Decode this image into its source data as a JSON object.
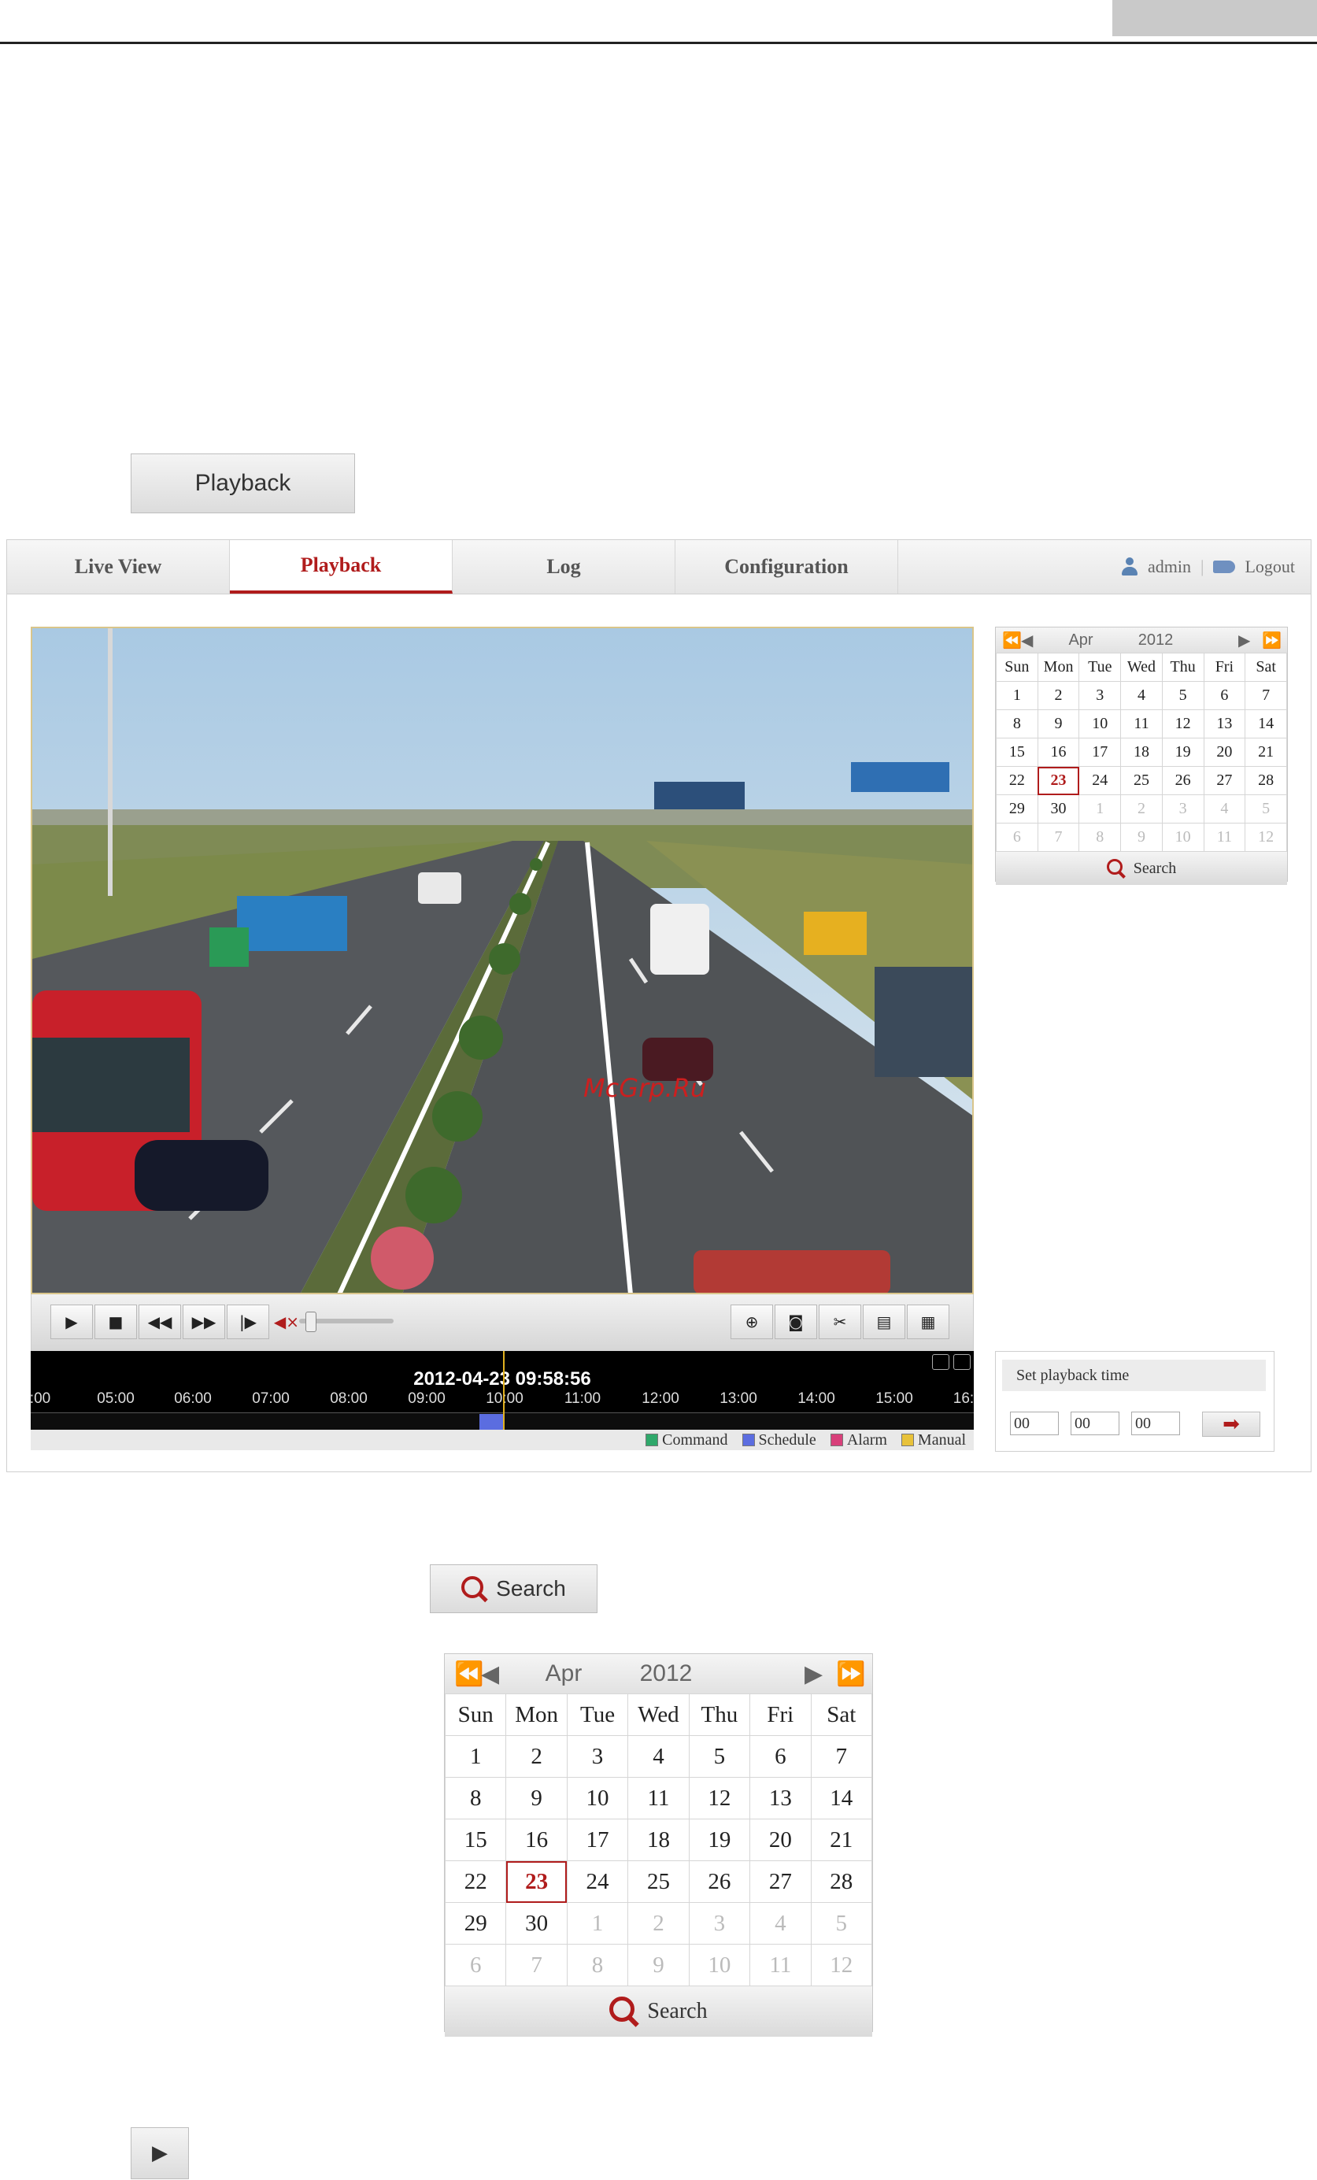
{
  "doc": {
    "playback_button": "Playback"
  },
  "nav": {
    "tabs": [
      "Live View",
      "Playback",
      "Log",
      "Configuration"
    ],
    "active_tab": "Playback",
    "user": "admin",
    "separator": "|",
    "logout": "Logout"
  },
  "player": {
    "watermark": "McGrp.Ru",
    "controls": [
      "play-icon",
      "stop-icon",
      "slow-forward-icon",
      "fast-forward-icon",
      "single-frame-icon",
      "volume-mute-icon",
      "zoom-in-icon",
      "capture-picture-icon",
      "clip-icon",
      "download-video-icon",
      "download-picture-icon"
    ],
    "timestamp": "2012-04-23 09:58:56",
    "ticks": [
      ":00",
      "05:00",
      "06:00",
      "07:00",
      "08:00",
      "09:00",
      "10:00",
      "11:00",
      "12:00",
      "13:00",
      "14:00",
      "15:00",
      "16:"
    ],
    "legend": [
      {
        "label": "Command",
        "color": "#2fa86b"
      },
      {
        "label": "Schedule",
        "color": "#5b6de0"
      },
      {
        "label": "Alarm",
        "color": "#d8407a"
      },
      {
        "label": "Manual",
        "color": "#e8c23a"
      }
    ]
  },
  "calendar": {
    "month": "Apr",
    "year": "2012",
    "weekdays": [
      "Sun",
      "Mon",
      "Tue",
      "Wed",
      "Thu",
      "Fri",
      "Sat"
    ],
    "weeks": [
      [
        "1",
        "2",
        "3",
        "4",
        "5",
        "6",
        "7"
      ],
      [
        "8",
        "9",
        "10",
        "11",
        "12",
        "13",
        "14"
      ],
      [
        "15",
        "16",
        "17",
        "18",
        "19",
        "20",
        "21"
      ],
      [
        "22",
        "23",
        "24",
        "25",
        "26",
        "27",
        "28"
      ],
      [
        "29",
        "30",
        "1",
        "2",
        "3",
        "4",
        "5"
      ],
      [
        "6",
        "7",
        "8",
        "9",
        "10",
        "11",
        "12"
      ]
    ],
    "selected": "23",
    "search_label": "Search"
  },
  "playback_time": {
    "title": "Set playback time",
    "hour": "00",
    "minute": "00",
    "second": "00"
  },
  "search_button": "Search",
  "colors": {
    "accent": "#b01c1c"
  }
}
